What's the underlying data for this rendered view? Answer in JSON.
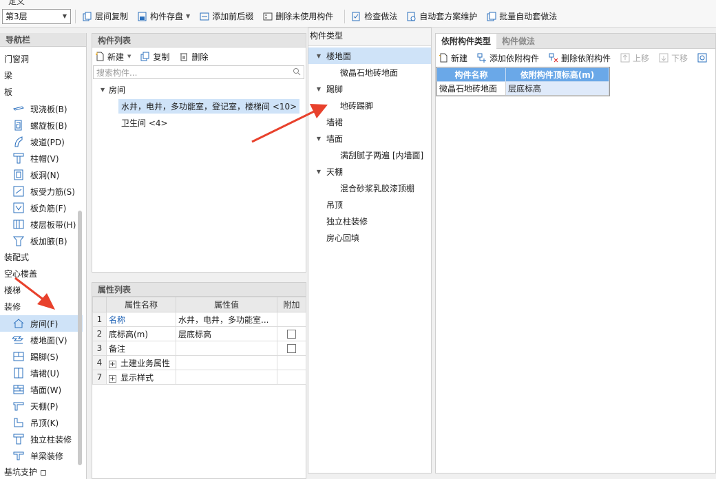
{
  "titlebar": {
    "title": "定义"
  },
  "toolbar": {
    "floor": "第3层",
    "buttons": [
      {
        "label": "层间复制",
        "icon": "copy-floor-icon",
        "caret": false
      },
      {
        "label": "构件存盘",
        "icon": "save-component-icon",
        "caret": true
      },
      {
        "label": "添加前后缀",
        "icon": "add-prefix-icon",
        "caret": false
      },
      {
        "label": "删除未使用构件",
        "icon": "delete-unused-icon",
        "caret": false
      },
      {
        "label": "检查做法",
        "icon": "check-method-icon",
        "caret": false
      },
      {
        "label": "自动套方案维护",
        "icon": "auto-plan-icon",
        "caret": false
      },
      {
        "label": "批量自动套做法",
        "icon": "batch-auto-icon",
        "caret": false
      }
    ]
  },
  "nav": {
    "title": "导航栏",
    "cats_top": [
      "门窗洞",
      "梁",
      "板"
    ],
    "board_items": [
      "现浇板(B)",
      "螺旋板(B)",
      "坡道(PD)",
      "柱帽(V)",
      "板洞(N)",
      "板受力筋(S)",
      "板负筋(F)",
      "楼层板带(H)",
      "板加腋(B)"
    ],
    "cats_mid": [
      "装配式",
      "空心楼盖",
      "楼梯",
      "装修"
    ],
    "deco_items": [
      "房间(F)",
      "楼地面(V)",
      "踢脚(S)",
      "墙裙(U)",
      "墙面(W)",
      "天棚(P)",
      "吊顶(K)",
      "独立柱装修",
      "单梁装修"
    ],
    "cat_bottom": "基坑支护"
  },
  "complist": {
    "title": "构件列表",
    "new_label": "新建",
    "copy_label": "复制",
    "delete_label": "删除",
    "search_placeholder": "搜索构件...",
    "tree": {
      "root": "房间",
      "items": [
        "水井，电井，多功能室，登记室，楼梯间 <10>",
        "卫生间 <4>"
      ]
    }
  },
  "props": {
    "title": "属性列表",
    "columns": [
      "属性名称",
      "属性值",
      "附加"
    ],
    "rows": [
      {
        "num": "1",
        "name": "名称",
        "value": "水井，电井，多功能室...",
        "expand": false,
        "checkbox": false,
        "link": true
      },
      {
        "num": "2",
        "name": "底标高(m)",
        "value": "层底标高",
        "expand": false,
        "checkbox": true,
        "link": false
      },
      {
        "num": "3",
        "name": "备注",
        "value": "",
        "expand": false,
        "checkbox": true,
        "link": false
      },
      {
        "num": "4",
        "name": "土建业务属性",
        "value": "",
        "expand": true,
        "checkbox": false,
        "link": false
      },
      {
        "num": "7",
        "name": "显示样式",
        "value": "",
        "expand": true,
        "checkbox": false,
        "link": false
      }
    ]
  },
  "ctype": {
    "title": "构件类型",
    "r0": "楼地面",
    "r1": "微晶石地砖地面",
    "r2": "踢脚",
    "r3": "地砖踢脚",
    "r4": "墙裙",
    "r5": "墙面",
    "r6": "满刮腻子两遍 [内墙面]",
    "r7": "天棚",
    "r8": "混合砂浆乳胶漆顶棚",
    "r9": "吊顶",
    "r10": "独立柱装修",
    "r11": "房心回填"
  },
  "rpanel": {
    "tabs": [
      "依附构件类型",
      "构件做法"
    ],
    "new_label": "新建",
    "add_label": "添加依附构件",
    "delete_label": "删除依附构件",
    "up_label": "上移",
    "down_label": "下移",
    "columns": [
      "构件名称",
      "依附构件顶标高(m)"
    ],
    "row": [
      "微晶石地砖地面",
      "层底标高"
    ]
  },
  "colors": {
    "selection": "#cfe3f8",
    "header_blue": "#6aa8e8",
    "arrow_red": "#e8412c"
  }
}
